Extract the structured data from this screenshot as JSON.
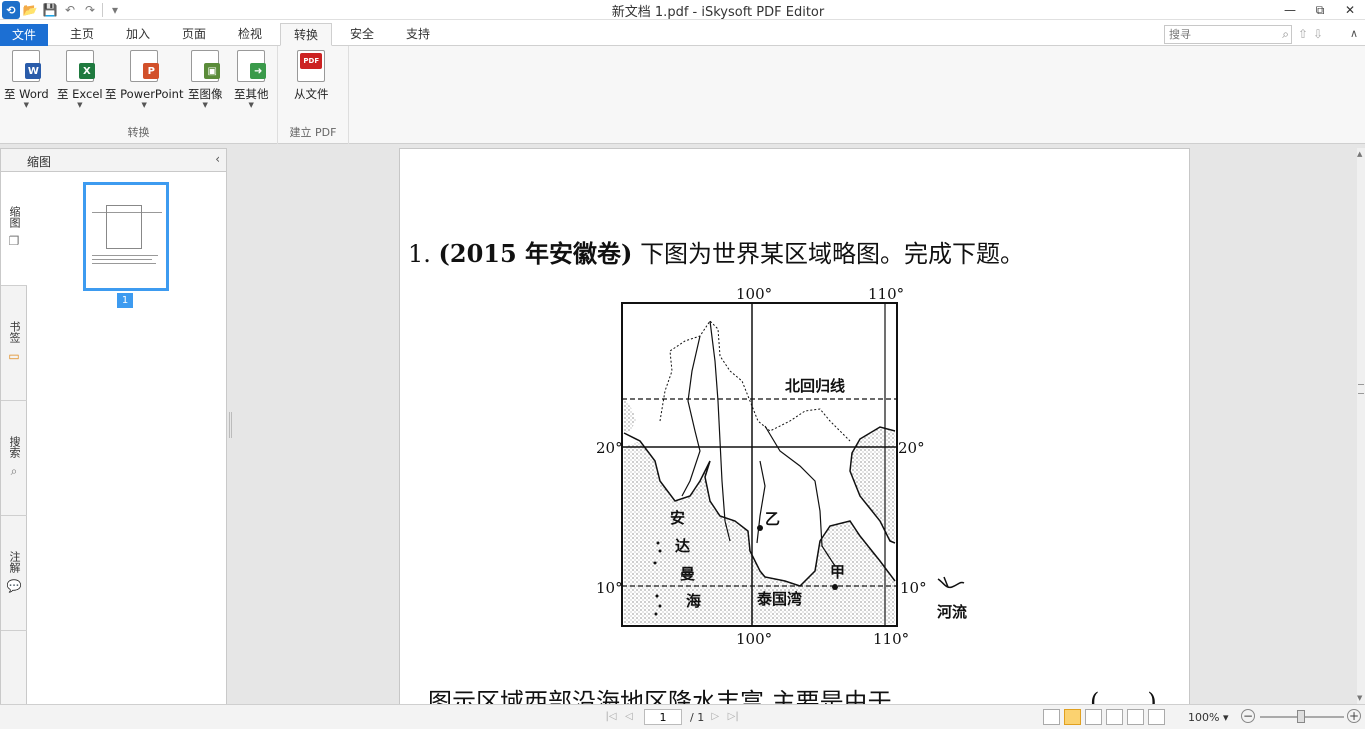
{
  "window": {
    "title": "新文档 1.pdf - iSkysoft PDF Editor",
    "app_icon_glyph": "⟲",
    "controls": {
      "minimize": "—",
      "restore": "⧉",
      "close": "✕"
    }
  },
  "quick_access": {
    "open": "📂",
    "save": "💾",
    "undo": "↶",
    "redo": "↷",
    "customize": "▾"
  },
  "tabs": [
    {
      "label": "文件"
    },
    {
      "label": "主页"
    },
    {
      "label": "加入"
    },
    {
      "label": "页面"
    },
    {
      "label": "检视"
    },
    {
      "label": "转换"
    },
    {
      "label": "安全"
    },
    {
      "label": "支持"
    }
  ],
  "search": {
    "placeholder": "搜寻"
  },
  "ribbon": {
    "convert_group": {
      "label": "转换",
      "buttons": [
        {
          "label": "至 Word",
          "badge": "W",
          "color": "#2a5caa"
        },
        {
          "label": "至 Excel",
          "badge": "X",
          "color": "#1f7a3f"
        },
        {
          "label": "至 PowerPoint",
          "badge": "P",
          "color": "#d2502a"
        },
        {
          "label": "至图像",
          "badge": "▣",
          "color": "#5b8c3a"
        },
        {
          "label": "至其他",
          "badge": "➜",
          "color": "#3a9a4a"
        }
      ]
    },
    "create_group": {
      "label": "建立 PDF",
      "buttons": [
        {
          "label": "从文件",
          "badge": "PDF",
          "color": "#cc2222"
        }
      ]
    }
  },
  "left_panel": {
    "title": "缩图",
    "collapse": "‹",
    "vertical_tabs": [
      {
        "label": "缩图",
        "icon": "❐"
      },
      {
        "label": "书签",
        "icon": "▭"
      },
      {
        "label": "搜索",
        "icon": "⌕"
      },
      {
        "label": "注解",
        "icon": "💬"
      }
    ],
    "thumbnail_page_number": "1"
  },
  "document": {
    "question_number": "1.",
    "question_source": "(2015 年安徽卷)",
    "question_text": "下图为世界某区域略图。完成下题。",
    "question_line2": "图示区域西部沿海地区降水丰富,主要是由于",
    "answer_paren": "(　　)",
    "map": {
      "lon_top_left": "100°",
      "lon_top_right": "110°",
      "lon_bottom_left": "100°",
      "lon_bottom_right": "110°",
      "lat_left_20": "20°",
      "lat_right_20": "20°",
      "lat_left_10": "10°",
      "lat_right_10": "10°",
      "tropic_label": "北回归线",
      "sea_chars": [
        "安",
        "达",
        "曼",
        "海"
      ],
      "gulf_label": "泰国湾",
      "point_yi": "乙",
      "point_jia": "甲",
      "legend_label": "河流"
    }
  },
  "statusbar": {
    "current_page": "1",
    "total_pages": "/ 1",
    "zoom": "100% ▾",
    "zoom_level_percent": 100
  }
}
